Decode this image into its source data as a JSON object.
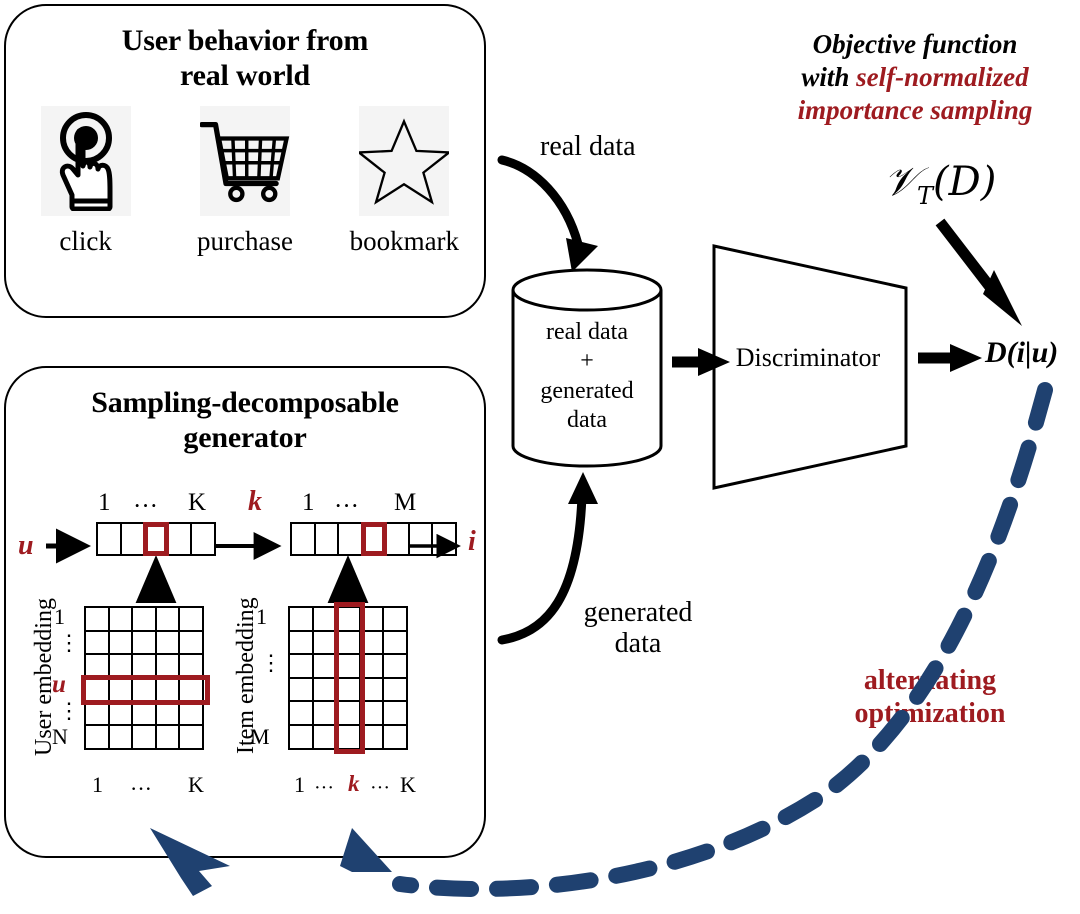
{
  "figure": {
    "colors": {
      "accent_red": "#9E1B20",
      "accent_navy": "#1F4170",
      "stroke_black": "#000000",
      "icon_bg": "#f4f4f4"
    }
  },
  "behavior_panel": {
    "title_line1": "User behavior from",
    "title_line2": "real world",
    "icons": [
      {
        "name": "click-icon",
        "caption": "click"
      },
      {
        "name": "purchase-cart-icon",
        "caption": "purchase"
      },
      {
        "name": "bookmark-star-icon",
        "caption": "bookmark"
      }
    ]
  },
  "generator_panel": {
    "title_line1": "Sampling-decomposable",
    "title_line2": "generator",
    "input_symbol": "u",
    "middle_symbol": "k",
    "output_symbol": "i",
    "vector_k": {
      "label_start": "1",
      "label_dots": "···",
      "label_end": "K",
      "cells": 5,
      "highlight_index": 2
    },
    "vector_m": {
      "label_start": "1",
      "label_dots": "···",
      "label_end": "M",
      "cells": 7,
      "highlight_index": 3
    },
    "user_embedding": {
      "axis_label": "User embedding",
      "row_top": "1",
      "row_dots_upper": "⋮",
      "row_highlight": "u",
      "row_dots_lower": "⋮",
      "row_bottom": "N",
      "col_start": "1",
      "col_dots": "···",
      "col_end": "K",
      "rows": 6,
      "cols": 5,
      "highlight_row_index": 3
    },
    "item_embedding": {
      "axis_label": "Item embedding",
      "row_top": "1",
      "row_dots": "⋮",
      "row_bottom": "M",
      "col_start": "1",
      "col_dots_left": "···",
      "col_highlight": "k",
      "col_dots_right": "···",
      "col_end": "K",
      "rows": 6,
      "cols": 5,
      "highlight_col_index": 2
    }
  },
  "flow": {
    "real_data_label": "real data",
    "generated_data_label": "generated\ndata",
    "generated_data_line1": "generated",
    "generated_data_line2": "data",
    "alternating_line1": "alternating",
    "alternating_line2": "optimization"
  },
  "datastore": {
    "line1": "real data",
    "line2": "+",
    "line3": "generated",
    "line4": "data"
  },
  "discriminator": {
    "label": "Discriminator"
  },
  "objective": {
    "line1_plain": "Objective function",
    "line2_plain": "with ",
    "line2_red": "self-normalized",
    "line3_red": "importance sampling",
    "formula_v": "𝒱",
    "formula_sub": "T",
    "formula_tail": "(D)",
    "output_label": "D(i|u)"
  }
}
